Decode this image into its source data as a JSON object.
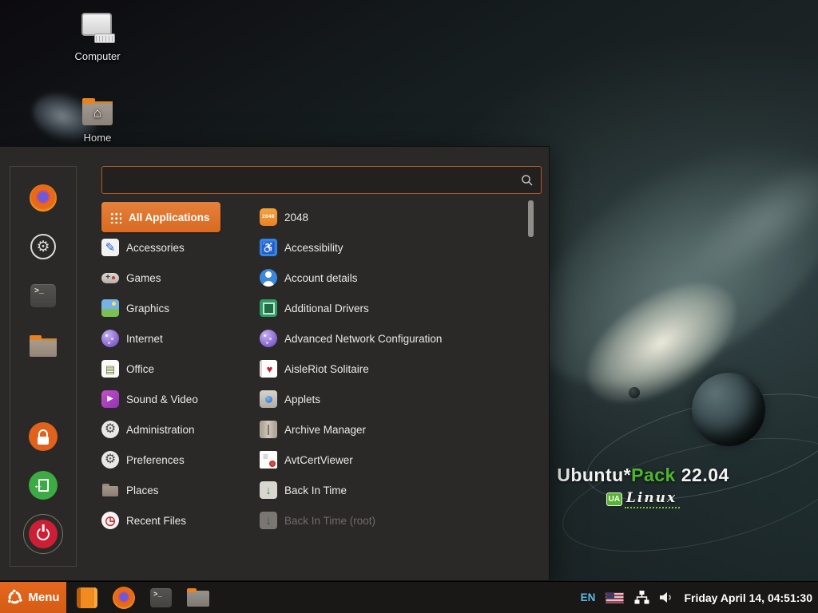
{
  "desktop": {
    "icons": [
      {
        "label": "Computer"
      },
      {
        "label": "Home"
      }
    ],
    "branding": {
      "title_white": "Ubuntu*",
      "title_green": "Pack",
      "title_version": " 22.04",
      "logo_badge": "UA",
      "logo_text": "Linux"
    }
  },
  "menu": {
    "search": {
      "placeholder": "",
      "value": ""
    },
    "favorites": [
      {
        "name": "firefox"
      },
      {
        "name": "system-settings"
      },
      {
        "name": "terminal"
      },
      {
        "name": "file-manager"
      }
    ],
    "session": [
      {
        "name": "lock-screen"
      },
      {
        "name": "logout"
      },
      {
        "name": "shutdown"
      }
    ],
    "categories": [
      {
        "label": "All Applications",
        "selected": true
      },
      {
        "label": "Accessories"
      },
      {
        "label": "Games"
      },
      {
        "label": "Graphics"
      },
      {
        "label": "Internet"
      },
      {
        "label": "Office"
      },
      {
        "label": "Sound & Video"
      },
      {
        "label": "Administration"
      },
      {
        "label": "Preferences"
      },
      {
        "label": "Places"
      },
      {
        "label": "Recent Files"
      }
    ],
    "apps": [
      {
        "label": "2048",
        "badge": "2048"
      },
      {
        "label": "Accessibility",
        "glyph": "♿"
      },
      {
        "label": "Account details"
      },
      {
        "label": "Additional Drivers"
      },
      {
        "label": "Advanced Network Configuration"
      },
      {
        "label": "AisleRiot Solitaire",
        "glyph": "♥"
      },
      {
        "label": "Applets"
      },
      {
        "label": "Archive Manager"
      },
      {
        "label": "AvtCertViewer"
      },
      {
        "label": "Back In Time",
        "glyph": "↓"
      },
      {
        "label": "Back In Time (root)",
        "glyph": "↓",
        "disabled": true
      }
    ],
    "category_glyphs": {
      "accessories": "✎",
      "games": "+",
      "office": "▤",
      "sound": "▶",
      "gear": "⚙",
      "recent": "◷"
    }
  },
  "taskbar": {
    "menu_label": "Menu",
    "launchers": [
      {
        "name": "package"
      },
      {
        "name": "firefox"
      },
      {
        "name": "terminal"
      },
      {
        "name": "file-manager"
      }
    ],
    "tray": {
      "language": "EN",
      "clock": "Friday April 14, 04:51:30"
    }
  },
  "colors": {
    "accent_orange": "#e0651f",
    "selected_orange": "#de7330",
    "menu_bg": "#2b2928",
    "taskbar_bg": "#191817",
    "language_blue": "#5fb9e6",
    "brand_green": "#4db82a"
  }
}
